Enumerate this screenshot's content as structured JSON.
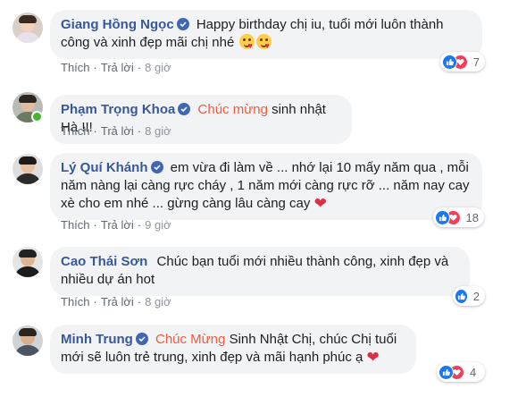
{
  "comments": [
    {
      "name": "Giang Hồng Ngọc",
      "text": "Happy birthday chị iu, tuổi mới luôn thành công và xinh đẹp mãi chị nhé",
      "emojis": [
        "smiling-face-with-hearts-emoji",
        "face-blowing-kiss-emoji"
      ],
      "like": "Thích",
      "reply": "Trả lời",
      "time": "8 giờ",
      "reaction_count": "7"
    },
    {
      "name": "Phạm Trọng Khoa",
      "highlight": "Chúc mừng",
      "text": " sinh nhật Hà !!!",
      "like": "Thích",
      "reply": "Trả lời",
      "time": "8 giờ"
    },
    {
      "name": "Lý Quí Khánh",
      "text": "em vừa đi làm về ... nhớ lại 10 mấy năm qua , mỗi năm nàng lại càng rực cháy , 1 năm mới càng rực rỡ ... năm nay cay xè cho em nhé ... gừng càng lâu càng cay",
      "like": "Thích",
      "reply": "Trả lời",
      "time": "9 giờ",
      "reaction_count": "18"
    },
    {
      "name": "Cao Thái Sơn",
      "text": "Chúc bạn tuổi mới nhiều thành công, xinh đẹp và nhiều dự án hot",
      "like": "Thích",
      "reply": "Trả lời",
      "time": "8 giờ",
      "reaction_count": "2"
    },
    {
      "name": "Minh Trung",
      "highlight": "Chúc Mừng",
      "text": " Sinh Nhật Chị, chúc Chị tuổi mới sẽ luôn trẻ trung, xinh đẹp và mãi hạnh phúc ạ",
      "like": "Thích",
      "reply": "Trả lời",
      "time": "8 giờ",
      "reaction_count": "4"
    }
  ],
  "colors": {
    "name": "#385898",
    "highlight": "#ef5c3f",
    "bubble": "#f2f3f5",
    "like_reaction": "#1877f2",
    "love_reaction": "#f33e58"
  }
}
